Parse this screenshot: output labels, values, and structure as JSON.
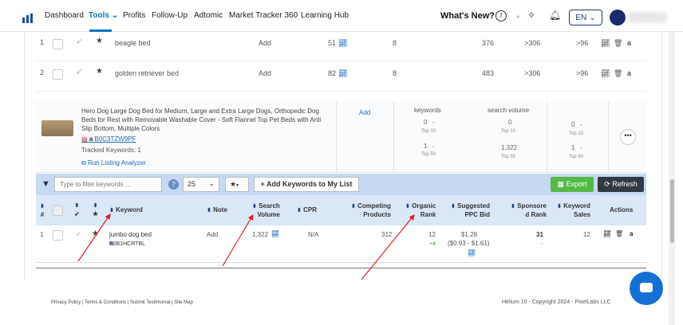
{
  "nav": {
    "items": [
      "Dashboard",
      "Tools",
      "Profits",
      "Follow-Up",
      "Adtomic",
      "Market Tracker 360",
      "Learning Hub"
    ],
    "whats_new": "What's New?",
    "lang": "EN"
  },
  "top_rows": [
    {
      "num": "1",
      "keyword": "beagle bed",
      "action": "Add",
      "search_volume": "51",
      "competing": "8",
      "col_a": "376",
      "col_b": ">306",
      "col_c": ">96"
    },
    {
      "num": "2",
      "keyword": "golden retriever bed",
      "action": "Add",
      "search_volume": "82",
      "competing": "8",
      "col_a": "483",
      "col_b": ">306",
      "col_c": ">96"
    }
  ],
  "product": {
    "title": "Hero Dog Large Dog Bed for Medium, Large and Extra Large Dogs, Orthopedic Dog Beds for Rest with Removable Washable Cover - Soft Flannel Top Pet Beds with Anti Slip Bottom, Multiple Colors",
    "asin": "B0C3TZW9PF",
    "tracked": "Tracked Keywords: 1",
    "analyzer": "Run Listing Analyzer",
    "add": "Add",
    "keywords_label": "keywords",
    "search_volume_label": "search volume",
    "kw_top10": "0",
    "kw_top10_label": "Top 10",
    "kw_top50": "1",
    "kw_top50_label": "Top 50",
    "sv_top10": "0",
    "sv_top10_label": "Top 10",
    "sv_top50": "1,322",
    "sv_top50_label": "Top 50",
    "r_top10": "0",
    "r_top10_label": "Top 10",
    "r_top50": "1",
    "r_top50_label": "Top 50",
    "dash": "-"
  },
  "toolbar": {
    "filter_placeholder": "Type to filter keywords ...",
    "per_page": "25",
    "add_keywords": "+ Add Keywords to My List",
    "export": "Export",
    "refresh": "Refresh"
  },
  "headers": {
    "num": "#",
    "keyword": "Keyword",
    "note": "Note",
    "search_volume_1": "Search",
    "search_volume_2": "Volume",
    "cpr": "CPR",
    "competing_1": "Competing",
    "competing_2": "Products",
    "organic_1": "Organic",
    "organic_2": "Rank",
    "ppc_1": "Suggested",
    "ppc_2": "PPC Bid",
    "sponsored_1": "Sponsore",
    "sponsored_2": "d Rank",
    "sales_1": "Keyword",
    "sales_2": "Sales",
    "actions": "Actions"
  },
  "data_row": {
    "num": "1",
    "keyword": "jumbo dog bed",
    "asin": "B0B1HCRTBL",
    "note": "Add",
    "search_volume": "1,322",
    "cpr": "N/A",
    "competing": "312",
    "organic_rank": "12",
    "organic_change": "+4",
    "ppc": "$1.28",
    "ppc_range": "($0.93 - $1.61)",
    "sponsored": "31",
    "sponsored_sub": "-",
    "sales": "12"
  },
  "footer": {
    "links": "Privacy Policy | Terms & Conditions | Submit Testimonial | Site Map",
    "copyright": "Helium 10 - Copyright 2024 - PixelLabs LLC"
  },
  "colors": {
    "accent": "#0e72c9",
    "export": "#56b947",
    "refresh": "#303a42",
    "arrow": "#e02020"
  }
}
